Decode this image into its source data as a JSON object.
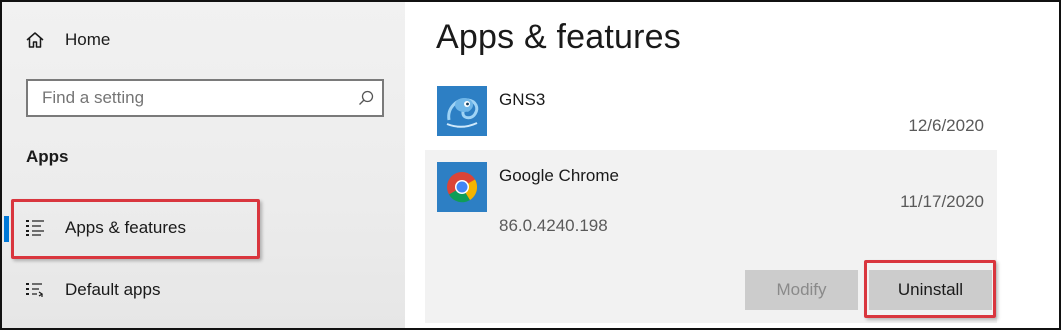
{
  "sidebar": {
    "home": {
      "label": "Home",
      "icon": "home-icon"
    },
    "search": {
      "placeholder": "Find a setting",
      "icon": "search-icon"
    },
    "section_title": "Apps",
    "items": [
      {
        "label": "Apps & features",
        "icon": "list-icon",
        "active": true
      },
      {
        "label": "Default apps",
        "icon": "default-apps-icon",
        "active": false
      }
    ]
  },
  "main": {
    "title": "Apps & features",
    "apps": [
      {
        "name": "GNS3",
        "date": "12/6/2020",
        "icon": "gns3-chameleon-icon"
      },
      {
        "name": "Google Chrome",
        "date": "11/17/2020",
        "version": "86.0.4240.198",
        "icon": "chrome-icon",
        "selected": true
      }
    ],
    "buttons": {
      "modify": "Modify",
      "uninstall": "Uninstall"
    }
  },
  "colors": {
    "accent": "#0078d7",
    "highlight": "#d9363e",
    "selected_row": "#f2f2f2",
    "button": "#cccccc"
  }
}
